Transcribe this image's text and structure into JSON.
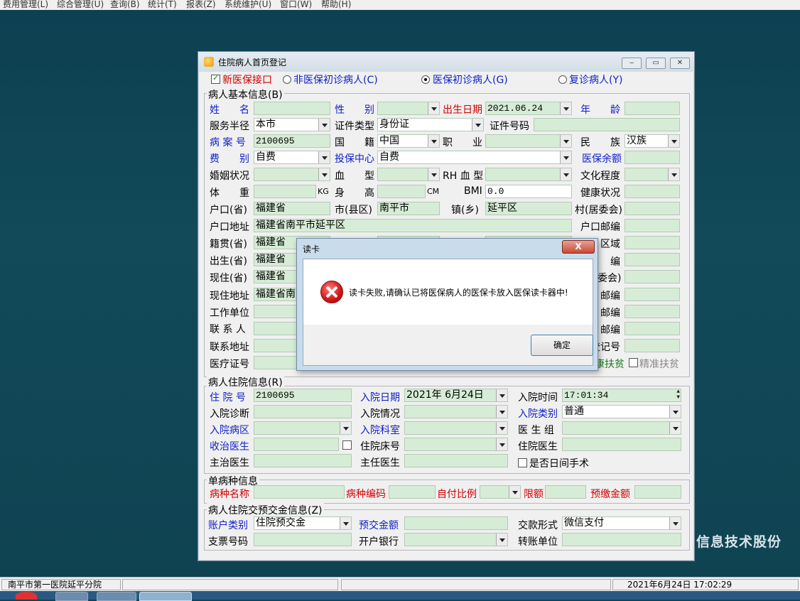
{
  "menubar": {
    "items": [
      "费用管理(L)",
      "综合管理(U)",
      "查询(B)",
      "统计(T)",
      "报表(Z)",
      "系统维护(U)",
      "窗口(W)",
      "帮助(H)"
    ]
  },
  "background_text": "信息技术股份",
  "window": {
    "title": "住院病人首页登记",
    "modes": {
      "new_ins": "新医保接口",
      "non_ins": "非医保初诊病人(C)",
      "ins_first": "医保初诊病人(G)",
      "revisit": "复诊病人(Y)"
    },
    "basic": {
      "title": "病人基本信息(B)",
      "labels": {
        "name": "姓　　名",
        "gender": "性　　别",
        "birth": "出生日期",
        "age": "年　　龄",
        "service": "服务半径",
        "idtype": "证件类型",
        "idno": "证件号码",
        "record": "病 案 号",
        "nation": "国　　籍",
        "job": "职　　业",
        "ethnic": "民　　族",
        "feetype": "费　　别",
        "center": "投保中心",
        "balance": "医保余额",
        "marriage": "婚姻状况",
        "blood": "血　　型",
        "rh": "RH 血 型",
        "edu": "文化程度",
        "weight": "体　　重",
        "kg": "KG",
        "height": "身　　高",
        "cm": "CM",
        "bmi": "BMI",
        "health": "健康状况",
        "hprov": "户口(省)",
        "hcity": "市(县区)",
        "htown": "镇(乡)",
        "hvillage": "村(居委会)",
        "haddr": "户口地址",
        "hpost": "户口邮编",
        "jprov": "籍贯(省)",
        "jarea": "区域",
        "bprov": "出生(省)",
        "bcode": "编",
        "cprov": "现住(省)",
        "cvill": "委会)",
        "caddr": "现住地址",
        "cpost": "邮编",
        "work": "工作单位",
        "wpost": "邮编",
        "contact": "联 系 人",
        "ctpost": "邮编",
        "caddr2": "联系地址",
        "reg": "登记号",
        "medcard": "医疗证号",
        "poverty": "康扶贫",
        "precise": "精准扶贫"
      },
      "values": {
        "birth": "2021.06.24",
        "service": "本市",
        "idtype": "身份证",
        "record": "2100695",
        "nation": "中国",
        "ethnic": "汉族",
        "feetype": "自费",
        "center": "自费",
        "bmi": "0.0",
        "hprov": "福建省",
        "hcity": "南平市",
        "htown": "延平区",
        "haddr": "福建省南平市延平区",
        "jprov": "福建省",
        "bprov": "福建省",
        "cprov": "福建省",
        "caddr": "福建省南"
      }
    },
    "admission": {
      "title": "病人住院信息(R)",
      "labels": {
        "no": "住 院 号",
        "date": "入院日期",
        "time": "入院时间",
        "diag": "入院诊断",
        "status": "入院情况",
        "type": "入院类别",
        "ward": "入院病区",
        "dept": "入院科室",
        "group": "医 生 组",
        "doctor": "收治医生",
        "bed": "住院床号",
        "indoctor": "住院医生",
        "chief": "主治医生",
        "director": "主任医生",
        "dayop": "是否日间手术"
      },
      "values": {
        "no": "2100695",
        "date": "2021年 6月24日",
        "time": "17:01:34",
        "type": "普通"
      }
    },
    "single": {
      "title": "单病种信息",
      "labels": {
        "name": "病种名称",
        "code": "病种编码",
        "ratio": "自付比例",
        "limit": "限额",
        "prepay": "预缴金额"
      }
    },
    "deposit": {
      "title": "病人住院交预交金信息(Z)",
      "labels": {
        "acct": "账户类别",
        "amount": "预交金额",
        "pay": "交款形式",
        "cheque": "支票号码",
        "bank": "开户银行",
        "unit": "转账单位"
      },
      "values": {
        "acct": "住院预交金",
        "pay": "微信支付"
      }
    }
  },
  "dialog": {
    "title": "读卡",
    "message": "读卡失败,请确认已将医保病人的医保卡放入医保读卡器中!",
    "ok": "确定",
    "close": "X"
  },
  "statusbar": {
    "hospital": "南平市第一医院延平分院",
    "datetime": "2021年6月24日  17:02:29"
  }
}
